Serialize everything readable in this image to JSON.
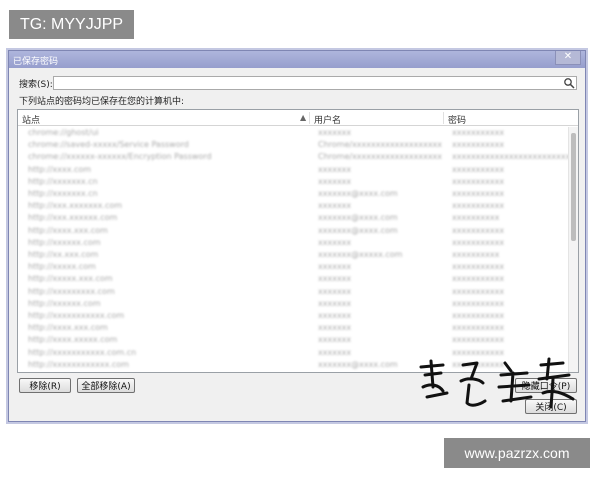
{
  "watermark_top": "TG: MYYJJPP",
  "watermark_bottom": "www.pazrzx.com",
  "window": {
    "title": "已保存密码",
    "close_glyph": "✕"
  },
  "search": {
    "label": "搜索(S):",
    "value": ""
  },
  "description": "下列站点的密码均已保存在您的计算机中:",
  "table": {
    "columns": [
      "站点",
      "用户名",
      "密码"
    ],
    "rows": [
      [
        "chrome://ghost/ui",
        "xxxxxxx",
        "xxxxxxxxxxx"
      ],
      [
        "chrome://saved-xxxxx/Service Password",
        "Chrome/xxxxxxxxxxxxxxxxxxx",
        "xxxxxxxxxxx"
      ],
      [
        "chrome://xxxxxx-xxxxxx/Encryption Password",
        "Chrome/xxxxxxxxxxxxxxxxxxx",
        "xxxxxxxxxxxxxxxxxxxxxxxxxxxx"
      ],
      [
        "http://xxxx.com",
        "xxxxxxx",
        "xxxxxxxxxxx"
      ],
      [
        "http://xxxxxxx.cn",
        "xxxxxxx",
        "xxxxxxxxxxx"
      ],
      [
        "http://xxxxxxx.cn",
        "xxxxxxx@xxxx.com",
        "xxxxxxxxxxx"
      ],
      [
        "http://xxx.xxxxxxx.com",
        "xxxxxxx",
        "xxxxxxxxxxx"
      ],
      [
        "http://xxx.xxxxxx.com",
        "xxxxxxx@xxxx.com",
        "xxxxxxxxxx"
      ],
      [
        "http://xxxx.xxx.com",
        "xxxxxxx@xxxx.com",
        "xxxxxxxxxxx"
      ],
      [
        "http://xxxxxx.com",
        "xxxxxxx",
        "xxxxxxxxxxx"
      ],
      [
        "http://xx.xxx.com",
        "xxxxxxx@xxxxx.com",
        "xxxxxxxxxx"
      ],
      [
        "http://xxxxx.com",
        "xxxxxxx",
        "xxxxxxxxxxx"
      ],
      [
        "http://xxxxx.xxx.com",
        "xxxxxxx",
        "xxxxxxxxxxx"
      ],
      [
        "http://xxxxxxxxx.com",
        "xxxxxxx",
        "xxxxxxxxxxx"
      ],
      [
        "http://xxxxxx.com",
        "xxxxxxx",
        "xxxxxxxxxxx"
      ],
      [
        "http://xxxxxxxxxxx.com",
        "xxxxxxx",
        "xxxxxxxxxxx"
      ],
      [
        "http://xxxx.xxx.com",
        "xxxxxxx",
        "xxxxxxxxxxx"
      ],
      [
        "http://xxxx.xxxxx.com",
        "xxxxxxx",
        "xxxxxxxxxxx"
      ],
      [
        "http://xxxxxxxxxxx.com.cn",
        "xxxxxxx",
        "xxxxxxxxxxx"
      ],
      [
        "http://xxxxxxxxxxxx.com",
        "xxxxxxx@xxxx.com",
        "xxxxxxxxxxx"
      ]
    ]
  },
  "buttons": {
    "remove": "移除(R)",
    "remove_all": "全部移除(A)",
    "hide": "隐藏口令(P)",
    "close": "关闭(C)"
  },
  "icons": {
    "search": "magnifier-icon",
    "sort": "sort-up-icon",
    "signature": "signature-stroke"
  }
}
